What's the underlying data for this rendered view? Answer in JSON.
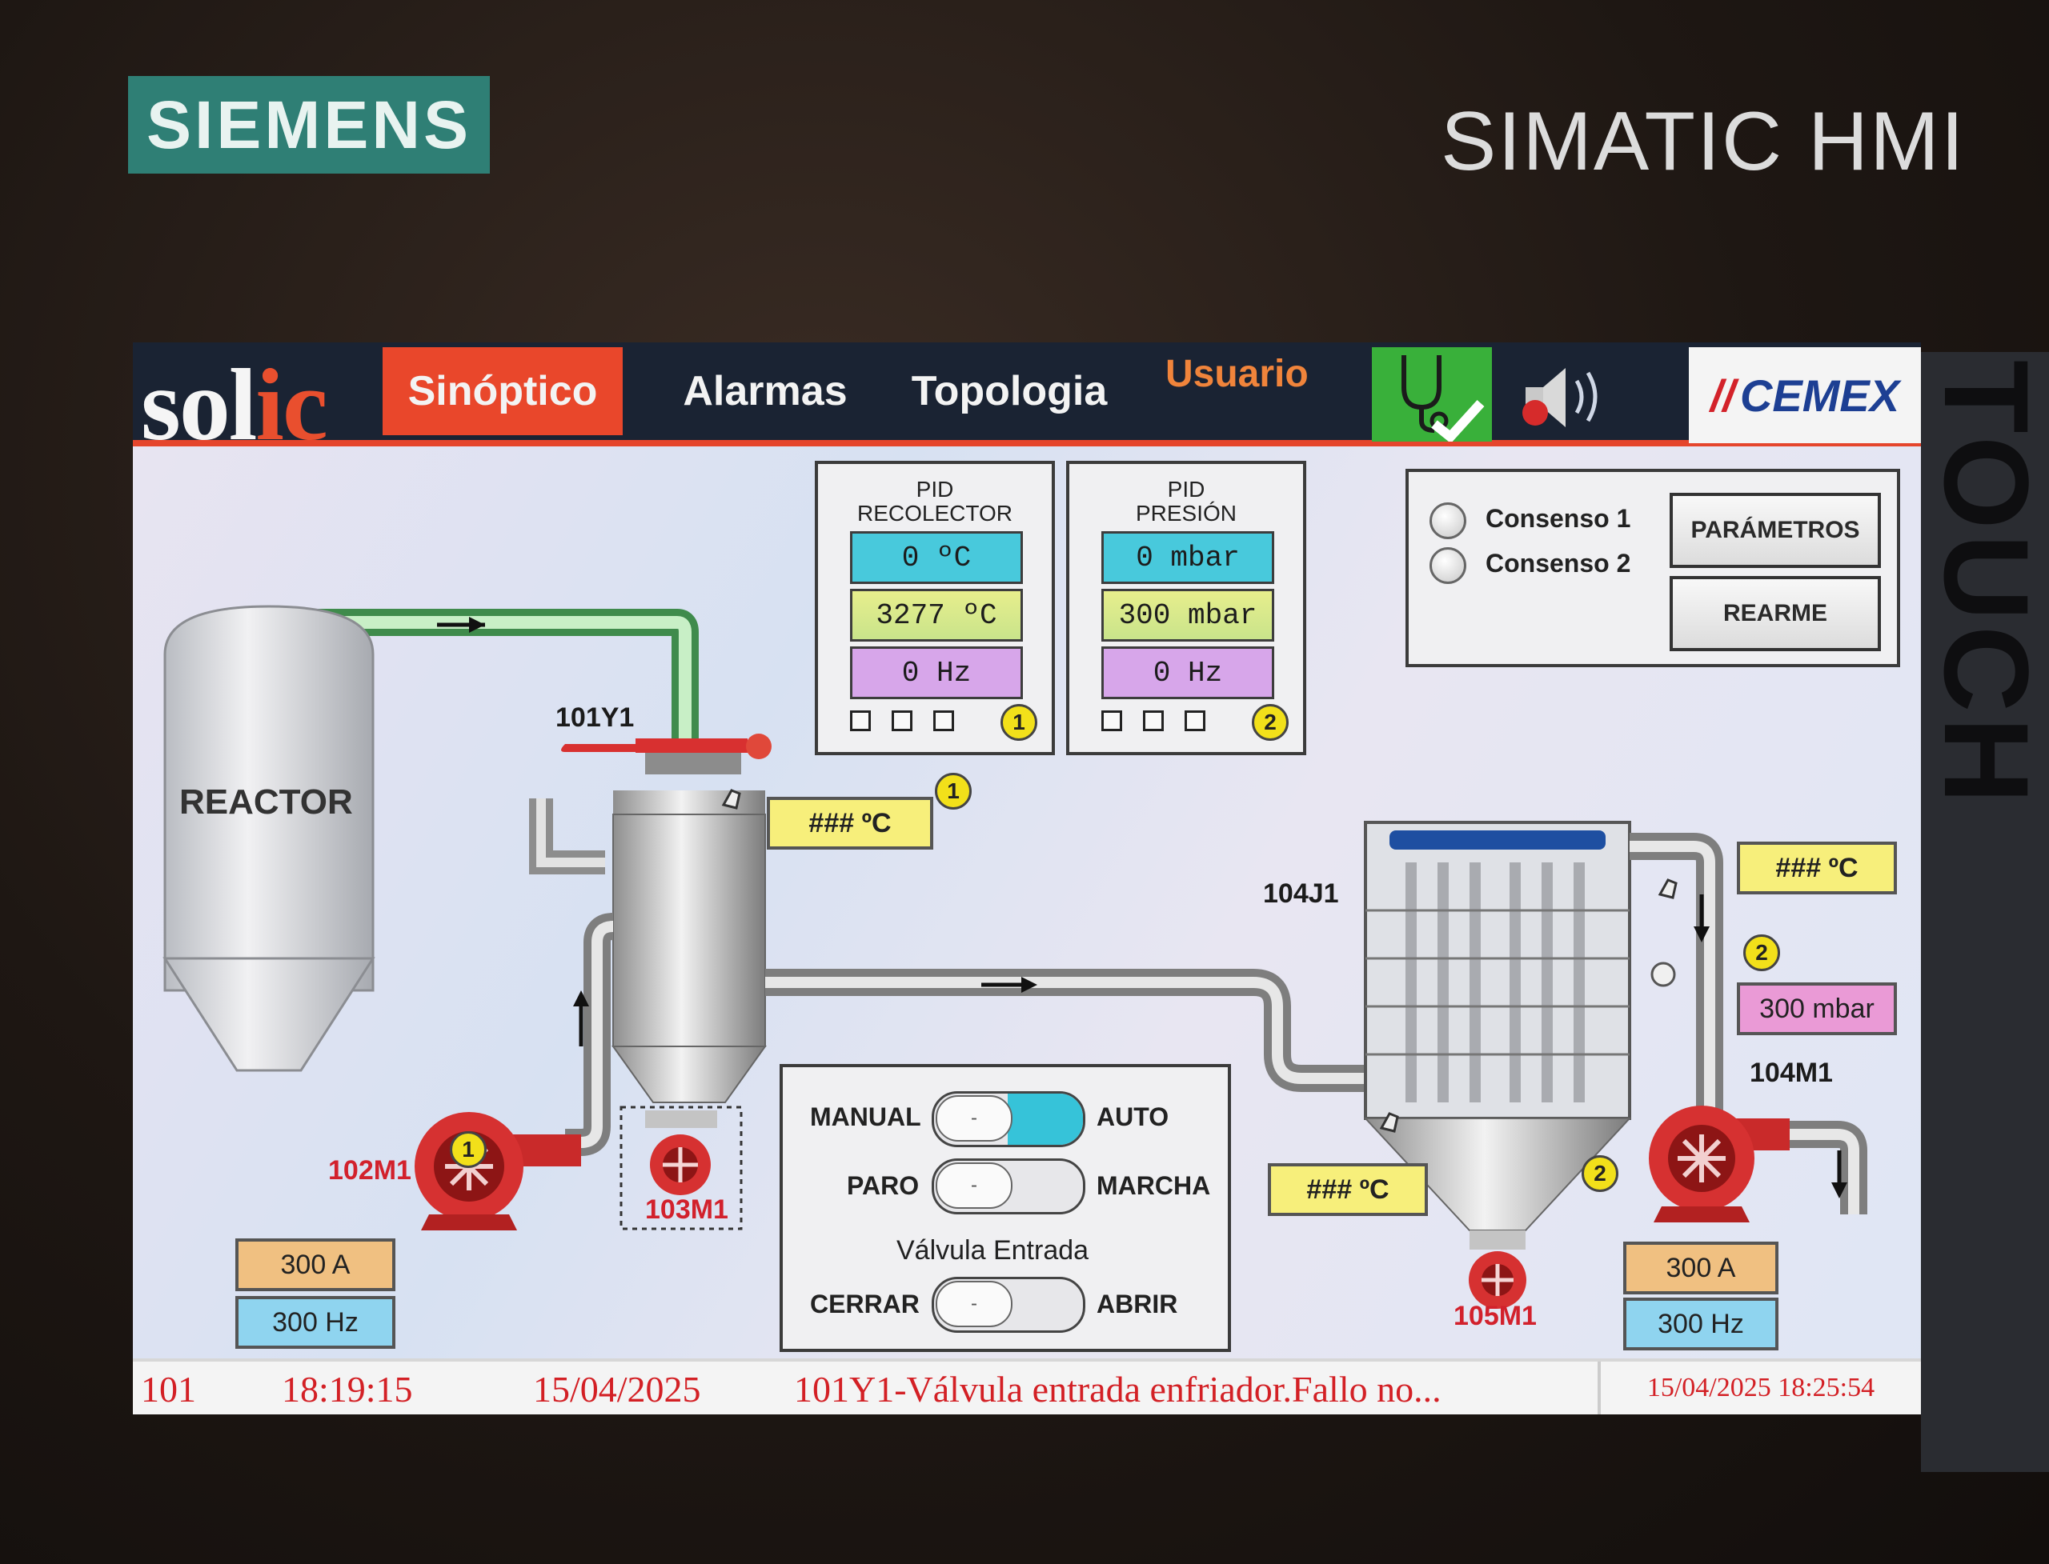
{
  "frame": {
    "brand": "SIEMENS",
    "model": "SIMATIC HMI",
    "side_label": "TOUCH"
  },
  "header": {
    "logo_main": "sol",
    "logo_accent": "ic",
    "tabs": [
      {
        "label": "Sinóptico",
        "active": true
      },
      {
        "label": "Alarmas",
        "active": false
      },
      {
        "label": "Topologia",
        "active": false
      }
    ],
    "user_label": "Usuario",
    "diagnostics_icon": "stethoscope-check-icon",
    "speaker_icon": "speaker-icon",
    "client_logo_mark": "//",
    "client_logo": "CEMEX",
    "colors": {
      "bar": "#1a2333",
      "accent": "#e9472b",
      "ok": "#39b03a"
    }
  },
  "pid_recolector": {
    "title_line1": "PID",
    "title_line2": "RECOLECTOR",
    "values": [
      "0 ºC",
      "3277 ºC",
      "0 Hz"
    ],
    "badge": "1"
  },
  "pid_presion": {
    "title_line1": "PID",
    "title_line2": "PRESIÓN",
    "values": [
      "0 mbar",
      "300 mbar",
      "0 Hz"
    ],
    "badge": "2"
  },
  "consensus": {
    "items": [
      "Consenso 1",
      "Consenso 2"
    ],
    "buttons": [
      "PARÁMETROS",
      "REARME"
    ]
  },
  "process": {
    "reactor": "REACTOR",
    "valve_101": "101Y1",
    "temp_cooler": "### ºC",
    "temp_cooler_badge": "1",
    "filter_104": "104J1",
    "temp_filter_out": "### ºC",
    "pressure_badge": "2",
    "pressure_value": "300 mbar",
    "fan_104": "104M1",
    "fan_102": "102M1",
    "fan_102_badge": "1",
    "fan_102_current": "300 A",
    "fan_102_freq": "300 Hz",
    "motor_103": "103M1",
    "temp_hopper": "### ºC",
    "temp_hopper_badge": "2",
    "motor_105": "105M1",
    "fan_104_current": "300 A",
    "fan_104_freq": "300 Hz"
  },
  "controls": {
    "row1": {
      "left": "MANUAL",
      "right": "AUTO",
      "state": "auto"
    },
    "row2": {
      "left": "PARO",
      "right": "MARCHA",
      "state": "paro"
    },
    "valve_title": "Válvula Entrada",
    "row3": {
      "left": "CERRAR",
      "right": "ABRIR",
      "state": "cerrar"
    },
    "knob_mark": "-"
  },
  "status_bar": {
    "code": "101",
    "time": "18:19:15",
    "date": "15/04/2025",
    "message": "101Y1-Válvula entrada enfriador.Fallo no...",
    "clock": "15/04/2025 18:25:54"
  }
}
